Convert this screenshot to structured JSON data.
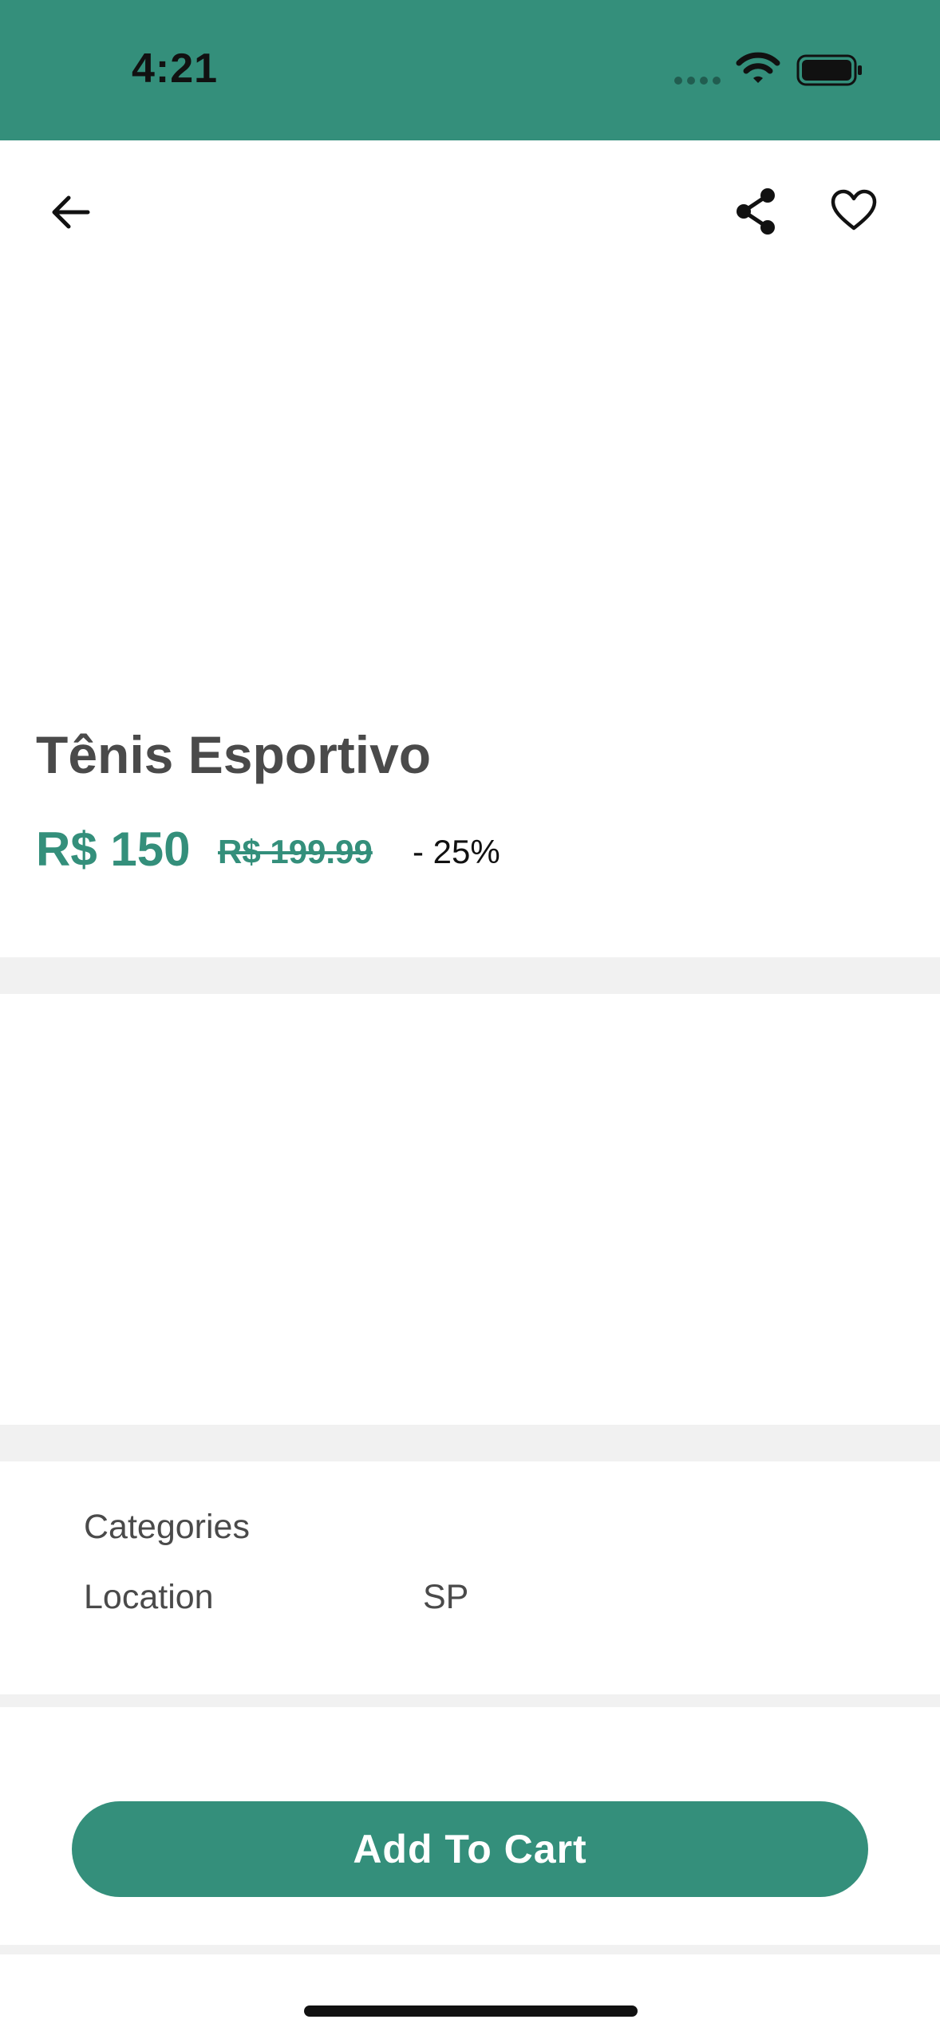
{
  "status_bar": {
    "time": "4:21",
    "icons": [
      "signal-dots-icon",
      "wifi-icon",
      "battery-icon"
    ],
    "background_color": "#348f7b"
  },
  "top_bar": {
    "icons": [
      "back-arrow-icon",
      "share-icon",
      "heart-icon"
    ]
  },
  "product": {
    "title": "Tênis Esportivo",
    "price": "R$ 150",
    "old_price": "R$ 199.99",
    "discount": "- 25%"
  },
  "details": {
    "rows": [
      {
        "label": "Categories",
        "value": ""
      },
      {
        "label": "Location",
        "value": "SP"
      }
    ]
  },
  "actions": {
    "add_to_cart_label": "Add To Cart"
  },
  "colors": {
    "accent": "#348f7b",
    "title_text": "#4a4a4a",
    "divider": "#f1f1f1"
  }
}
